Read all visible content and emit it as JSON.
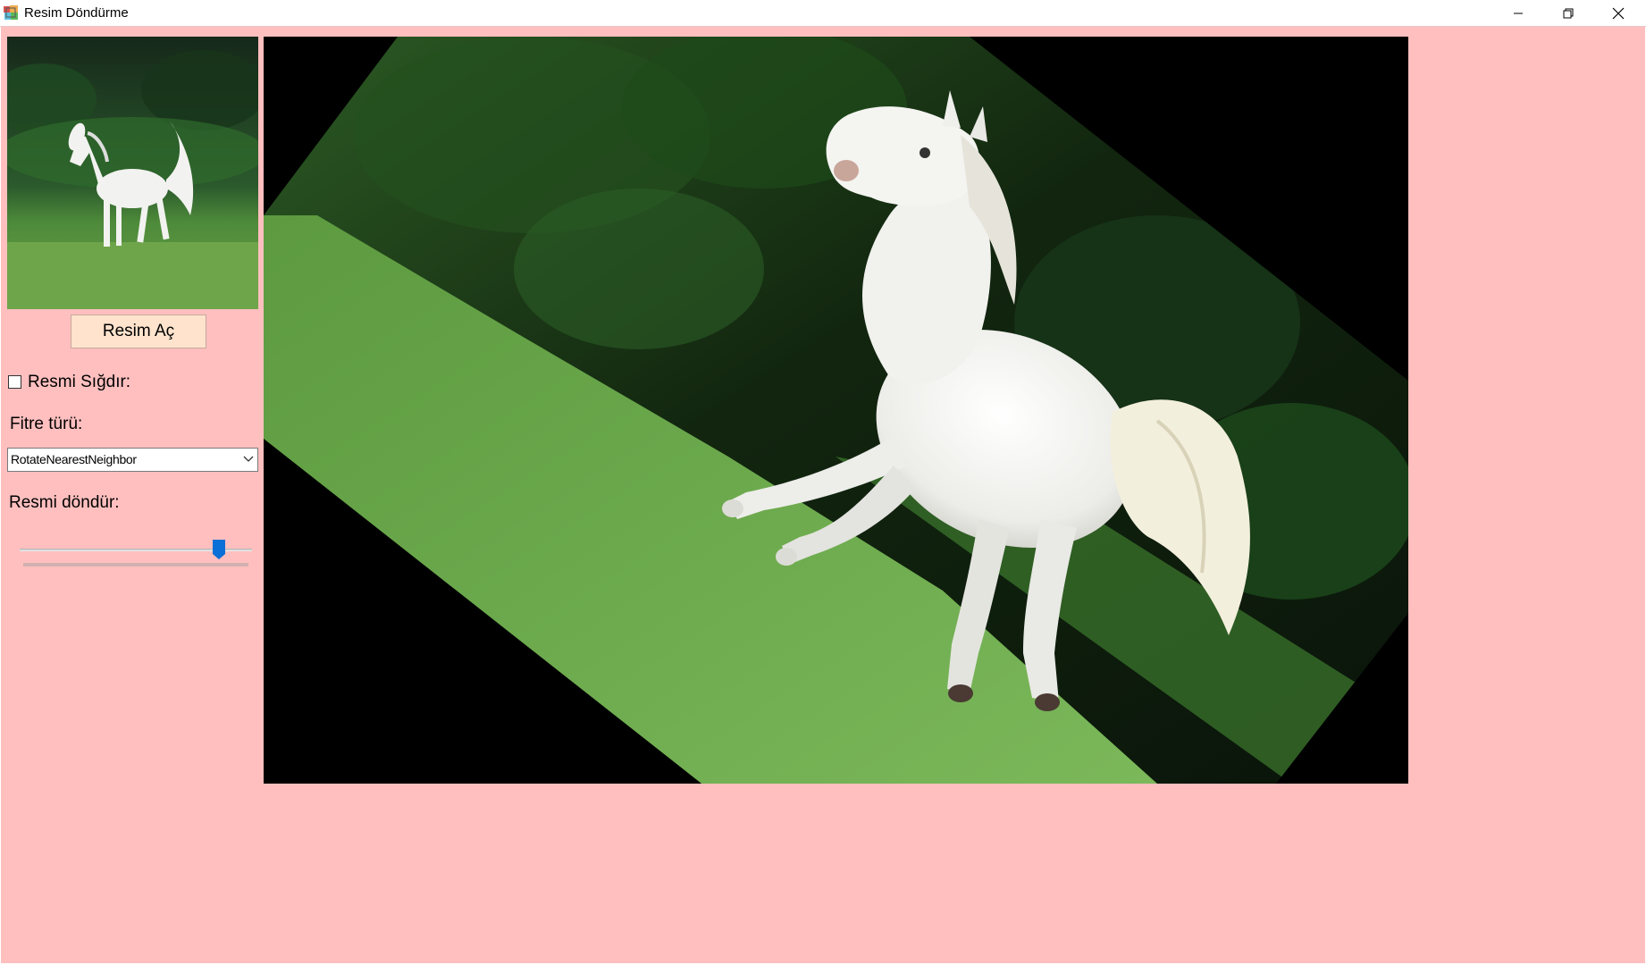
{
  "window": {
    "title": "Resim Döndürme",
    "background_color": "#ffbfbf"
  },
  "sidebar": {
    "open_button_label": "Resim Aç",
    "fit_checkbox_label": "Resmi Sığdır:",
    "fit_checked": false,
    "filter_label": "Fitre türü:",
    "filter_selected": "RotateNearestNeighbor",
    "rotate_label": "Resmi döndür:",
    "rotate_slider_fraction": 0.88
  },
  "icons": {
    "app": "app-icon",
    "minimize": "minimize-icon",
    "maximize": "restore-icon",
    "close": "close-icon",
    "dropdown": "chevron-down-icon"
  },
  "colors": {
    "button_bg": "#ffe3cd",
    "slider_thumb": "#0a6fd6",
    "client_bg": "#ffbfbf"
  }
}
